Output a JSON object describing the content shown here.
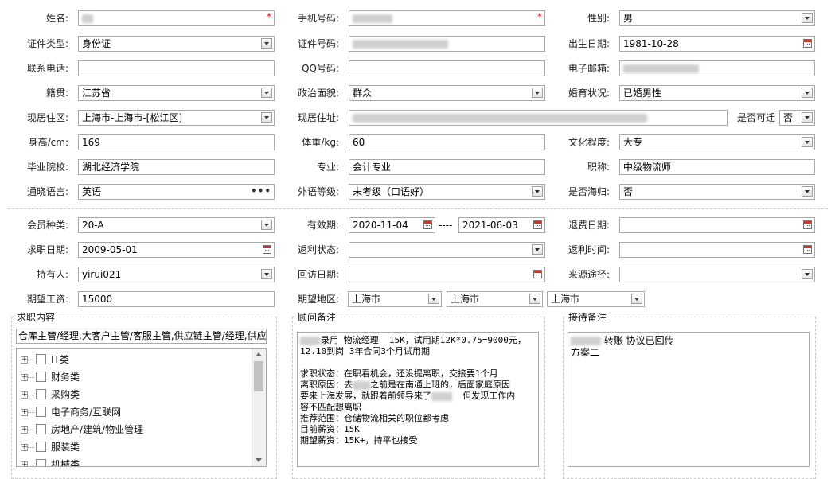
{
  "row1": {
    "name_label": "姓名:",
    "phone_label": "手机号码:",
    "gender_label": "性别:",
    "gender_value": "男",
    "required_mark": "*"
  },
  "row2": {
    "idtype_label": "证件类型:",
    "idtype_value": "身份证",
    "idno_label": "证件号码:",
    "birth_label": "出生日期:",
    "birth_value": "1981-10-28"
  },
  "row3": {
    "contact_label": "联系电话:",
    "qq_label": "QQ号码:",
    "email_label": "电子邮箱:"
  },
  "row4": {
    "native_label": "籍贯:",
    "native_value": "江苏省",
    "political_label": "政治面貌:",
    "political_value": "群众",
    "marital_label": "婚育状况:",
    "marital_value": "已婚男性"
  },
  "row5": {
    "area_label": "现居住区:",
    "area_value": "上海市-上海市-[松江区]",
    "addr_label": "现居住址:",
    "relocate_label": "是否可迁",
    "relocate_value": "否"
  },
  "row6": {
    "height_label": "身高/cm:",
    "height_value": "169",
    "weight_label": "体重/kg:",
    "weight_value": "60",
    "edu_label": "文化程度:",
    "edu_value": "大专"
  },
  "row7": {
    "school_label": "毕业院校:",
    "school_value": "湖北经济学院",
    "major_label": "专业:",
    "major_value": "会计专业",
    "title_label": "职称:",
    "title_value": "中级物流师"
  },
  "row8": {
    "lang_label": "通晓语言:",
    "lang_value": "英语",
    "lang_more": "•••",
    "level_label": "外语等级:",
    "level_value": "未考级（口语好）",
    "overseas_label": "是否海归:",
    "overseas_value": "否"
  },
  "row9": {
    "member_label": "会员种类:",
    "member_value": "20-A",
    "valid_label": "有效期:",
    "valid_from": "2020-11-04",
    "valid_sep": "----",
    "valid_to": "2021-06-03",
    "refund_label": "退费日期:"
  },
  "row10": {
    "apply_label": "求职日期:",
    "apply_value": "2009-05-01",
    "rebate_label": "返利状态:",
    "rebate_time_label": "返利时间:"
  },
  "row11": {
    "holder_label": "持有人:",
    "holder_value": "yirui021",
    "visit_label": "回访日期:",
    "source_label": "来源途径:"
  },
  "row12": {
    "salary_label": "期望工资:",
    "salary_value": "15000",
    "region_label": "期望地区:",
    "region1": "上海市",
    "region2": "上海市",
    "region3": "上海市"
  },
  "job": {
    "legend": "求职内容",
    "summary": "仓库主管/经理,大客户主管/客服主管,供应链主管/经理,供应",
    "items": [
      {
        "label": "IT类"
      },
      {
        "label": "财务类"
      },
      {
        "label": "采购类"
      },
      {
        "label": "电子商务/互联网"
      },
      {
        "label": "房地产/建筑/物业管理"
      },
      {
        "label": "服装类"
      },
      {
        "label": "机械类"
      }
    ]
  },
  "advisor": {
    "legend": "顾问备注",
    "line1": "录用 物流经理  15K，试用期12K*0.75=9000元，",
    "line2": "12.10到岗 3年合同3个月试用期",
    "line3": "求职状态：在职看机会，还没提离职，交接要1个月",
    "line4a": "离职原因：去",
    "line4b": "之前是在南通上班的，后面家庭原因",
    "line5a": "要来上海发展，就跟着前领导来了",
    "line5b": "  但发现工作内",
    "line6": "容不匹配想离职",
    "line7": "推荐范围：仓储物流相关的职位都考虑",
    "line8": "目前薪资：15K",
    "line9": "期望薪资：15K+，持平也接受"
  },
  "reception": {
    "legend": "接待备注",
    "line1": " 转账 协议已回传",
    "line2": "方案二"
  }
}
